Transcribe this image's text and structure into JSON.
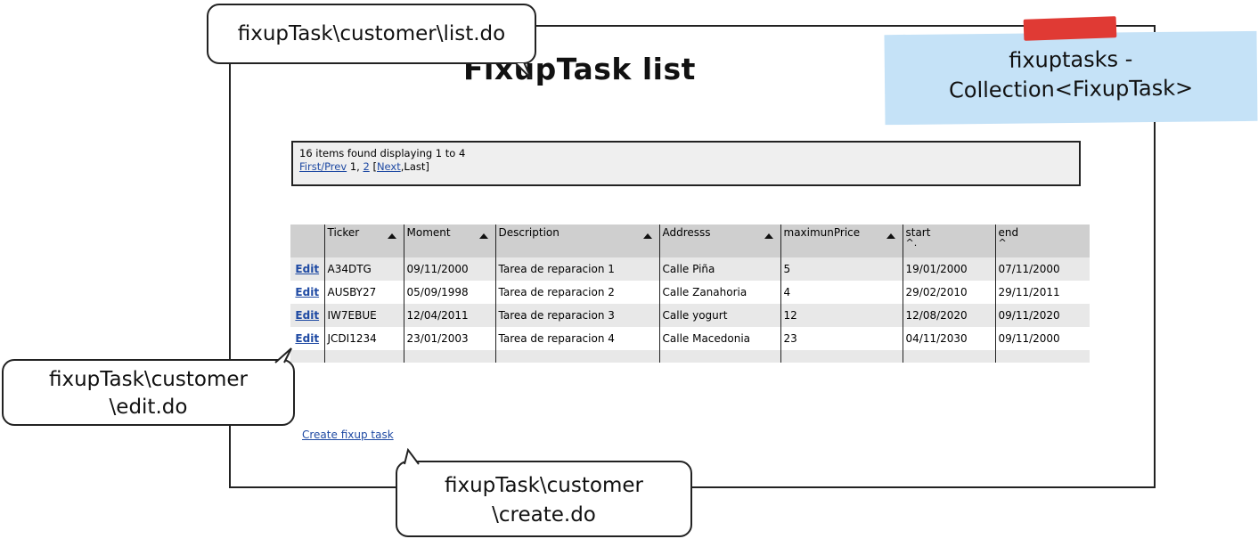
{
  "page": {
    "title": "FixupTask list"
  },
  "note": {
    "line1": "fixuptasks -",
    "line2": "Collection<FixupTask>"
  },
  "callouts": {
    "list": "fixupTask\\customer\\list.do",
    "edit_line1": "fixupTask\\customer",
    "edit_line2": "\\edit.do",
    "create_line1": "fixupTask\\customer",
    "create_line2": "\\create.do"
  },
  "pager": {
    "summary": "16 items found displaying 1 to 4",
    "first_prev": "First/Prev",
    "current": "1",
    "sep": ",",
    "page2": "2",
    "bracket_open": "[",
    "next": "Next",
    "last": ",Last]"
  },
  "table": {
    "headers": [
      "Ticker",
      "Moment",
      "Description",
      "Addresss",
      "maximunPrice",
      "start",
      "end"
    ],
    "header_carets": {
      "start": "^.",
      "end": "^"
    },
    "edit_label": "Edit",
    "rows": [
      [
        "A34DTG",
        "09/11/2000",
        "Tarea de reparacion 1",
        "Calle Piña",
        "5",
        "19/01/2000",
        "07/11/2000"
      ],
      [
        "AUSBY27",
        "05/09/1998",
        "Tarea de reparacion 2",
        "Calle Zanahoria",
        "4",
        "29/02/2010",
        "29/11/2011"
      ],
      [
        "IW7EBUE",
        "12/04/2011",
        "Tarea de reparacion 3",
        "Calle yogurt",
        "12",
        "12/08/2020",
        "09/11/2020"
      ],
      [
        "JCDI1234",
        "23/01/2003",
        "Tarea de reparacion 4",
        "Calle Macedonia",
        "23",
        "04/11/2030",
        "09/11/2000"
      ]
    ]
  },
  "create_link": "Create fixup task",
  "colors": {
    "link": "#1f4aa3",
    "note_bg": "#c5e2f7",
    "tape": "#e03a34",
    "header_bg": "#cfcfcf"
  }
}
